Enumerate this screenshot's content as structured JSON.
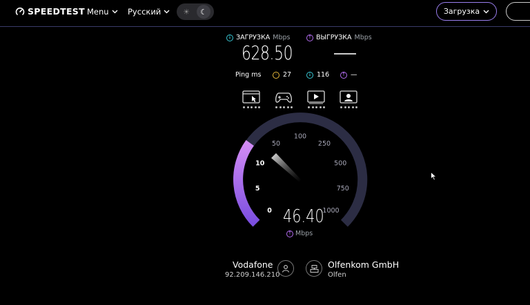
{
  "header": {
    "logo_text": "SPEEDTEST",
    "menu_label": "Menu",
    "language_label": "Русский",
    "download_button_label": "Загрузка"
  },
  "results": {
    "download_label": "ЗАГРУЗКА",
    "download_unit": "Mbps",
    "download_value": "628.50",
    "upload_label": "ВЫГРУЗКА",
    "upload_unit": "Mbps",
    "ping_label": "Ping ms",
    "ping_idle": "27",
    "ping_download": "116",
    "ping_upload": "—"
  },
  "gauge": {
    "ticks": [
      "0",
      "5",
      "10",
      "50",
      "100",
      "250",
      "500",
      "750",
      "1000"
    ],
    "current_speed": "46.40",
    "current_unit": "Mbps",
    "progress_fraction": 0.3
  },
  "connection": {
    "isp_name": "Vodafone",
    "isp_ip": "92.209.146.210",
    "server_name": "Olfenkom GmbH",
    "server_location": "Olfen"
  },
  "colors": {
    "accent_purple": "#b36cf0",
    "download_cyan": "#38c7d4",
    "ping_yellow": "#e8b93a",
    "track": "#2c2d44"
  }
}
